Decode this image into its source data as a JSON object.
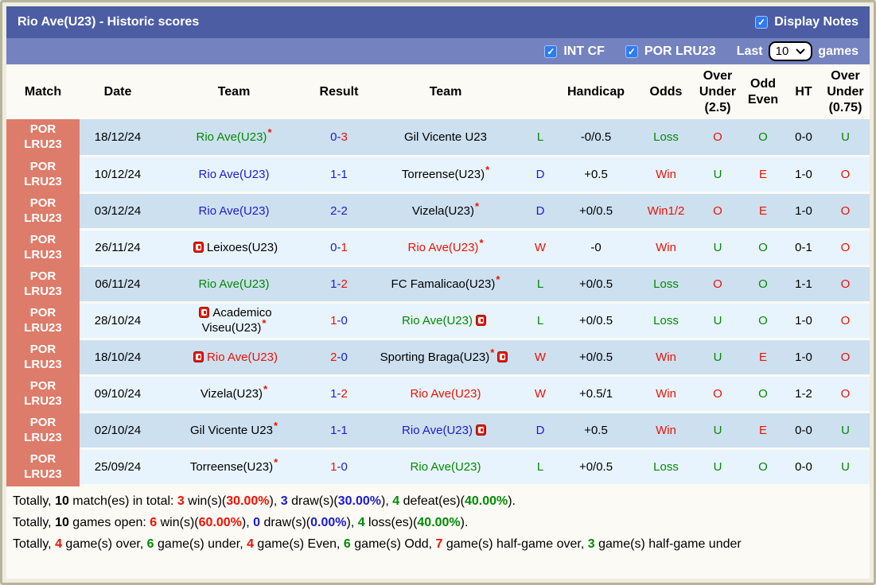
{
  "colors": {
    "title_bar": "#4c5da4",
    "filter_bar": "#7482bf",
    "match_col": "#dd7c6a",
    "row_odd": "#cde0f0",
    "row_even": "#e8f4fd",
    "page_bg": "#f0ecdf",
    "content_bg": "#fbfaf5",
    "border": "#b7b49c",
    "red": "#ee1100",
    "blue": "#1c1ccd",
    "green": "#028a02",
    "checkbox_blue": "#2e7cf0",
    "card_red": "#e8190c"
  },
  "icons": {
    "checkmark": "✓",
    "star": "*"
  },
  "header": {
    "title": "Rio Ave(U23) - Historic scores",
    "display_notes": {
      "label": "Display Notes",
      "checked": true
    },
    "filters": [
      {
        "label": "INT CF",
        "checked": true
      },
      {
        "label": "POR LRU23",
        "checked": true
      }
    ],
    "last_games": {
      "prefix": "Last",
      "selected": "10",
      "suffix": "games"
    }
  },
  "table": {
    "columns": [
      "Match",
      "Date",
      "Team",
      "Result",
      "Team",
      "",
      "Handicap",
      "Odds",
      "Over\nUnder\n(2.5)",
      "Odd\nEven",
      "HT",
      "Over\nUnder\n(0.75)"
    ],
    "rows": [
      {
        "league": "POR\nLRU23",
        "date": "18/12/24",
        "home": {
          "name": "Rio Ave(U23)",
          "color": "green",
          "star": true
        },
        "result": {
          "h": "0",
          "hc": "blue",
          "a": "3",
          "ac": "red"
        },
        "away": {
          "name": "Gil Vicente U23",
          "color": "black"
        },
        "wdl": {
          "t": "L",
          "c": "green"
        },
        "handicap": "-0/0.5",
        "odds": {
          "t": "Loss",
          "c": "green"
        },
        "over_under_25": {
          "t": "O",
          "c": "red"
        },
        "odd_even": {
          "t": "O",
          "c": "green"
        },
        "ht": "0-0",
        "over_under_075": {
          "t": "U",
          "c": "green"
        }
      },
      {
        "league": "POR\nLRU23",
        "date": "10/12/24",
        "home": {
          "name": "Rio Ave(U23)",
          "color": "blue"
        },
        "result": {
          "h": "1",
          "hc": "blue",
          "a": "1",
          "ac": "blue"
        },
        "away": {
          "name": "Torreense(U23)",
          "color": "black",
          "star": true
        },
        "wdl": {
          "t": "D",
          "c": "blue"
        },
        "handicap": "+0.5",
        "odds": {
          "t": "Win",
          "c": "red"
        },
        "over_under_25": {
          "t": "U",
          "c": "green"
        },
        "odd_even": {
          "t": "E",
          "c": "red"
        },
        "ht": "1-0",
        "over_under_075": {
          "t": "O",
          "c": "red"
        }
      },
      {
        "league": "POR\nLRU23",
        "date": "03/12/24",
        "home": {
          "name": "Rio Ave(U23)",
          "color": "blue"
        },
        "result": {
          "h": "2",
          "hc": "blue",
          "a": "2",
          "ac": "blue"
        },
        "away": {
          "name": "Vizela(U23)",
          "color": "black",
          "star": true
        },
        "wdl": {
          "t": "D",
          "c": "blue"
        },
        "handicap": "+0/0.5",
        "odds": {
          "t": "Win1/2",
          "c": "red"
        },
        "over_under_25": {
          "t": "O",
          "c": "red"
        },
        "odd_even": {
          "t": "E",
          "c": "red"
        },
        "ht": "1-0",
        "over_under_075": {
          "t": "O",
          "c": "red"
        }
      },
      {
        "league": "POR\nLRU23",
        "date": "26/11/24",
        "home": {
          "name": "Leixoes(U23)",
          "color": "black",
          "card_before": true
        },
        "result": {
          "h": "0",
          "hc": "blue",
          "a": "1",
          "ac": "red"
        },
        "away": {
          "name": "Rio Ave(U23)",
          "color": "red",
          "star": true
        },
        "wdl": {
          "t": "W",
          "c": "red"
        },
        "handicap": "-0",
        "odds": {
          "t": "Win",
          "c": "red"
        },
        "over_under_25": {
          "t": "U",
          "c": "green"
        },
        "odd_even": {
          "t": "O",
          "c": "green"
        },
        "ht": "0-1",
        "over_under_075": {
          "t": "O",
          "c": "red"
        }
      },
      {
        "league": "POR\nLRU23",
        "date": "06/11/24",
        "home": {
          "name": "Rio Ave(U23)",
          "color": "green"
        },
        "result": {
          "h": "1",
          "hc": "blue",
          "a": "2",
          "ac": "red"
        },
        "away": {
          "name": "FC Famalicao(U23)",
          "color": "black",
          "star": true
        },
        "wdl": {
          "t": "L",
          "c": "green"
        },
        "handicap": "+0/0.5",
        "odds": {
          "t": "Loss",
          "c": "green"
        },
        "over_under_25": {
          "t": "O",
          "c": "red"
        },
        "odd_even": {
          "t": "O",
          "c": "green"
        },
        "ht": "1-1",
        "over_under_075": {
          "t": "O",
          "c": "red"
        }
      },
      {
        "league": "POR\nLRU23",
        "date": "28/10/24",
        "home": {
          "name": "Academico\nViseu(U23)",
          "color": "black",
          "star": true,
          "card_before": true
        },
        "result": {
          "h": "1",
          "hc": "red",
          "a": "0",
          "ac": "blue"
        },
        "away": {
          "name": "Rio Ave(U23)",
          "color": "green",
          "card_after": true
        },
        "wdl": {
          "t": "L",
          "c": "green"
        },
        "handicap": "+0/0.5",
        "odds": {
          "t": "Loss",
          "c": "green"
        },
        "over_under_25": {
          "t": "U",
          "c": "green"
        },
        "odd_even": {
          "t": "O",
          "c": "green"
        },
        "ht": "1-0",
        "over_under_075": {
          "t": "O",
          "c": "red"
        }
      },
      {
        "league": "POR\nLRU23",
        "date": "18/10/24",
        "home": {
          "name": "Rio Ave(U23)",
          "color": "red",
          "card_before": true
        },
        "result": {
          "h": "2",
          "hc": "red",
          "a": "0",
          "ac": "blue"
        },
        "away": {
          "name": "Sporting Braga(U23)",
          "color": "black",
          "star": true,
          "card_after": true
        },
        "wdl": {
          "t": "W",
          "c": "red"
        },
        "handicap": "+0/0.5",
        "odds": {
          "t": "Win",
          "c": "red"
        },
        "over_under_25": {
          "t": "U",
          "c": "green"
        },
        "odd_even": {
          "t": "E",
          "c": "red"
        },
        "ht": "1-0",
        "over_under_075": {
          "t": "O",
          "c": "red"
        }
      },
      {
        "league": "POR\nLRU23",
        "date": "09/10/24",
        "home": {
          "name": "Vizela(U23)",
          "color": "black",
          "star": true
        },
        "result": {
          "h": "1",
          "hc": "blue",
          "a": "2",
          "ac": "red"
        },
        "away": {
          "name": "Rio Ave(U23)",
          "color": "red"
        },
        "wdl": {
          "t": "W",
          "c": "red"
        },
        "handicap": "+0.5/1",
        "odds": {
          "t": "Win",
          "c": "red"
        },
        "over_under_25": {
          "t": "O",
          "c": "red"
        },
        "odd_even": {
          "t": "O",
          "c": "green"
        },
        "ht": "1-2",
        "over_under_075": {
          "t": "O",
          "c": "red"
        }
      },
      {
        "league": "POR\nLRU23",
        "date": "02/10/24",
        "home": {
          "name": "Gil Vicente U23",
          "color": "black",
          "star": true
        },
        "result": {
          "h": "1",
          "hc": "blue",
          "a": "1",
          "ac": "blue"
        },
        "away": {
          "name": "Rio Ave(U23)",
          "color": "blue",
          "card_after": true
        },
        "wdl": {
          "t": "D",
          "c": "blue"
        },
        "handicap": "+0.5",
        "odds": {
          "t": "Win",
          "c": "red"
        },
        "over_under_25": {
          "t": "U",
          "c": "green"
        },
        "odd_even": {
          "t": "E",
          "c": "red"
        },
        "ht": "0-0",
        "over_under_075": {
          "t": "U",
          "c": "green"
        }
      },
      {
        "league": "POR\nLRU23",
        "date": "25/09/24",
        "home": {
          "name": "Torreense(U23)",
          "color": "black",
          "star": true
        },
        "result": {
          "h": "1",
          "hc": "red",
          "a": "0",
          "ac": "blue"
        },
        "away": {
          "name": "Rio Ave(U23)",
          "color": "green"
        },
        "wdl": {
          "t": "L",
          "c": "green"
        },
        "handicap": "+0/0.5",
        "odds": {
          "t": "Loss",
          "c": "green"
        },
        "over_under_25": {
          "t": "U",
          "c": "green"
        },
        "odd_even": {
          "t": "O",
          "c": "green"
        },
        "ht": "0-0",
        "over_under_075": {
          "t": "U",
          "c": "green"
        }
      }
    ]
  },
  "footer": {
    "lines": [
      [
        {
          "t": "Totally, "
        },
        {
          "t": "10",
          "b": 1
        },
        {
          "t": " match(es) in total: "
        },
        {
          "t": "3",
          "c": "red",
          "b": 1
        },
        {
          "t": " win(s)("
        },
        {
          "t": "30.00%",
          "c": "red",
          "b": 1
        },
        {
          "t": "), "
        },
        {
          "t": "3",
          "c": "blue",
          "b": 1
        },
        {
          "t": " draw(s)("
        },
        {
          "t": "30.00%",
          "c": "blue",
          "b": 1
        },
        {
          "t": "), "
        },
        {
          "t": "4",
          "c": "green",
          "b": 1
        },
        {
          "t": " defeat(es)("
        },
        {
          "t": "40.00%",
          "c": "green",
          "b": 1
        },
        {
          "t": ")."
        }
      ],
      [
        {
          "t": "Totally, "
        },
        {
          "t": "10",
          "b": 1
        },
        {
          "t": " games open: "
        },
        {
          "t": "6",
          "c": "red",
          "b": 1
        },
        {
          "t": " win(s)("
        },
        {
          "t": "60.00%",
          "c": "red",
          "b": 1
        },
        {
          "t": "), "
        },
        {
          "t": "0",
          "c": "blue",
          "b": 1
        },
        {
          "t": " draw(s)("
        },
        {
          "t": "0.00%",
          "c": "blue",
          "b": 1
        },
        {
          "t": "), "
        },
        {
          "t": "4",
          "c": "green",
          "b": 1
        },
        {
          "t": " loss(es)("
        },
        {
          "t": "40.00%",
          "c": "green",
          "b": 1
        },
        {
          "t": ")."
        }
      ],
      [
        {
          "t": "Totally, "
        },
        {
          "t": "4",
          "c": "red",
          "b": 1
        },
        {
          "t": " game(s) over, "
        },
        {
          "t": "6",
          "c": "green",
          "b": 1
        },
        {
          "t": " game(s) under, "
        },
        {
          "t": "4",
          "c": "red",
          "b": 1
        },
        {
          "t": " game(s) Even, "
        },
        {
          "t": "6",
          "c": "green",
          "b": 1
        },
        {
          "t": " game(s) Odd, "
        },
        {
          "t": "7",
          "c": "red",
          "b": 1
        },
        {
          "t": " game(s) half-game over, "
        },
        {
          "t": "3",
          "c": "green",
          "b": 1
        },
        {
          "t": " game(s) half-game under"
        }
      ]
    ]
  }
}
